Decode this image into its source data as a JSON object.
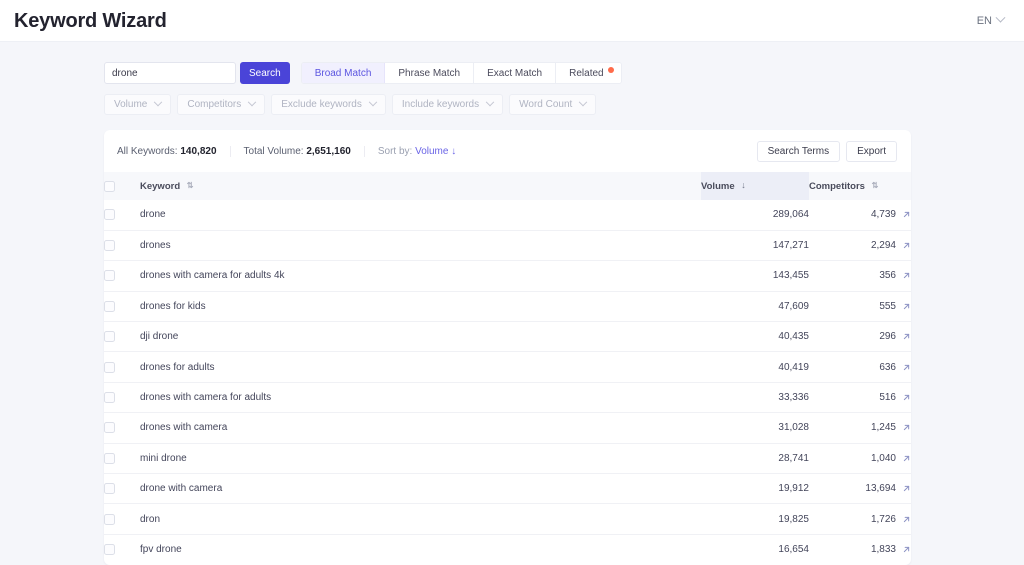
{
  "header": {
    "title": "Keyword Wizard",
    "language": "EN",
    "language_caret": "chevron-down-icon"
  },
  "search": {
    "value": "drone",
    "placeholder": "drone",
    "button_label": "Search",
    "match_tabs": [
      {
        "label": "Broad Match",
        "active": true,
        "badge": false
      },
      {
        "label": "Phrase Match",
        "active": false,
        "badge": false
      },
      {
        "label": "Exact Match",
        "active": false,
        "badge": false
      },
      {
        "label": "Related",
        "active": false,
        "badge": true
      }
    ]
  },
  "filters": [
    {
      "label": "Volume"
    },
    {
      "label": "Competitors"
    },
    {
      "label": "Exclude keywords"
    },
    {
      "label": "Include keywords"
    },
    {
      "label": "Word Count"
    }
  ],
  "card": {
    "summary": {
      "all_keywords_label": "All Keywords:",
      "all_keywords_value": "140,820",
      "total_volume_label": "Total Volume:",
      "total_volume_value": "2,651,160",
      "sort_by_label": "Sort by:",
      "sort_by_value": "Volume ↓"
    },
    "actions": {
      "search_terms_label": "Search Terms",
      "export_label": "Export"
    },
    "columns": {
      "keyword": "Keyword",
      "volume": "Volume",
      "competitors": "Competitors",
      "keyword_sort_icon": "⇅",
      "volume_sort_icon": "↓",
      "competitors_sort_icon": "⇅"
    },
    "rows": [
      {
        "keyword": "drone",
        "volume": "289,064",
        "competitors": "4,739"
      },
      {
        "keyword": "drones",
        "volume": "147,271",
        "competitors": "2,294"
      },
      {
        "keyword": "drones with camera for adults 4k",
        "volume": "143,455",
        "competitors": "356"
      },
      {
        "keyword": "drones for kids",
        "volume": "47,609",
        "competitors": "555"
      },
      {
        "keyword": "dji drone",
        "volume": "40,435",
        "competitors": "296"
      },
      {
        "keyword": "drones for adults",
        "volume": "40,419",
        "competitors": "636"
      },
      {
        "keyword": "drones with camera for adults",
        "volume": "33,336",
        "competitors": "516"
      },
      {
        "keyword": "drones with camera",
        "volume": "31,028",
        "competitors": "1,245"
      },
      {
        "keyword": "mini drone",
        "volume": "28,741",
        "competitors": "1,040"
      },
      {
        "keyword": "drone with camera",
        "volume": "19,912",
        "competitors": "13,694"
      },
      {
        "keyword": "dron",
        "volume": "19,825",
        "competitors": "1,726"
      },
      {
        "keyword": "fpv drone",
        "volume": "16,654",
        "competitors": "1,833"
      }
    ]
  },
  "colors": {
    "accent": "#4a44d8",
    "accent_soft": "#f1f0fe",
    "badge": "#ff6b4a",
    "page_bg": "#f5f6fa",
    "link": "#6a64e6"
  }
}
